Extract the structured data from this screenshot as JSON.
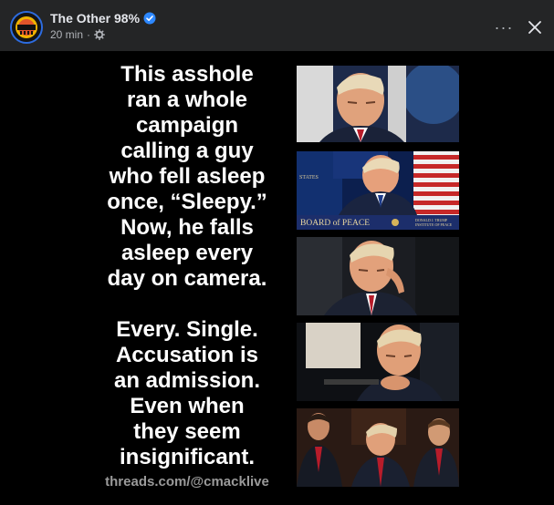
{
  "header": {
    "author": "The Other 98%",
    "timestamp": "20 min",
    "dot": "·",
    "more_label": "···"
  },
  "icons": {
    "avatar": "the-other-98-logo",
    "verified": "verified-badge-icon",
    "audience": "gear-icon",
    "more": "more-options-icon",
    "close": "close-icon"
  },
  "colors": {
    "background": "#242526",
    "image_background": "#000000",
    "verified": "#2d88ff",
    "text_primary": "#e4e6eb",
    "text_secondary": "#b0b3b8"
  },
  "meme": {
    "block1_lines": [
      "This asshole",
      "ran a whole",
      "campaign",
      "calling a guy",
      "who fell asleep",
      "once, “Sleepy.”",
      "Now, he falls",
      "asleep every",
      "day on camera."
    ],
    "block2_lines": [
      "Every. Single.",
      "Accusation is",
      "an admission.",
      "Even when",
      "they seem",
      "insignificant."
    ],
    "watermark": "threads.com/@cmacklive"
  },
  "photos": {
    "sign_main": "BOARD of PEACE",
    "sign_small": "DONALD J. TRUMP INSTITUTE OF PEACE",
    "sign_top": "BOARD PEACE",
    "sign_left": "STATES"
  }
}
